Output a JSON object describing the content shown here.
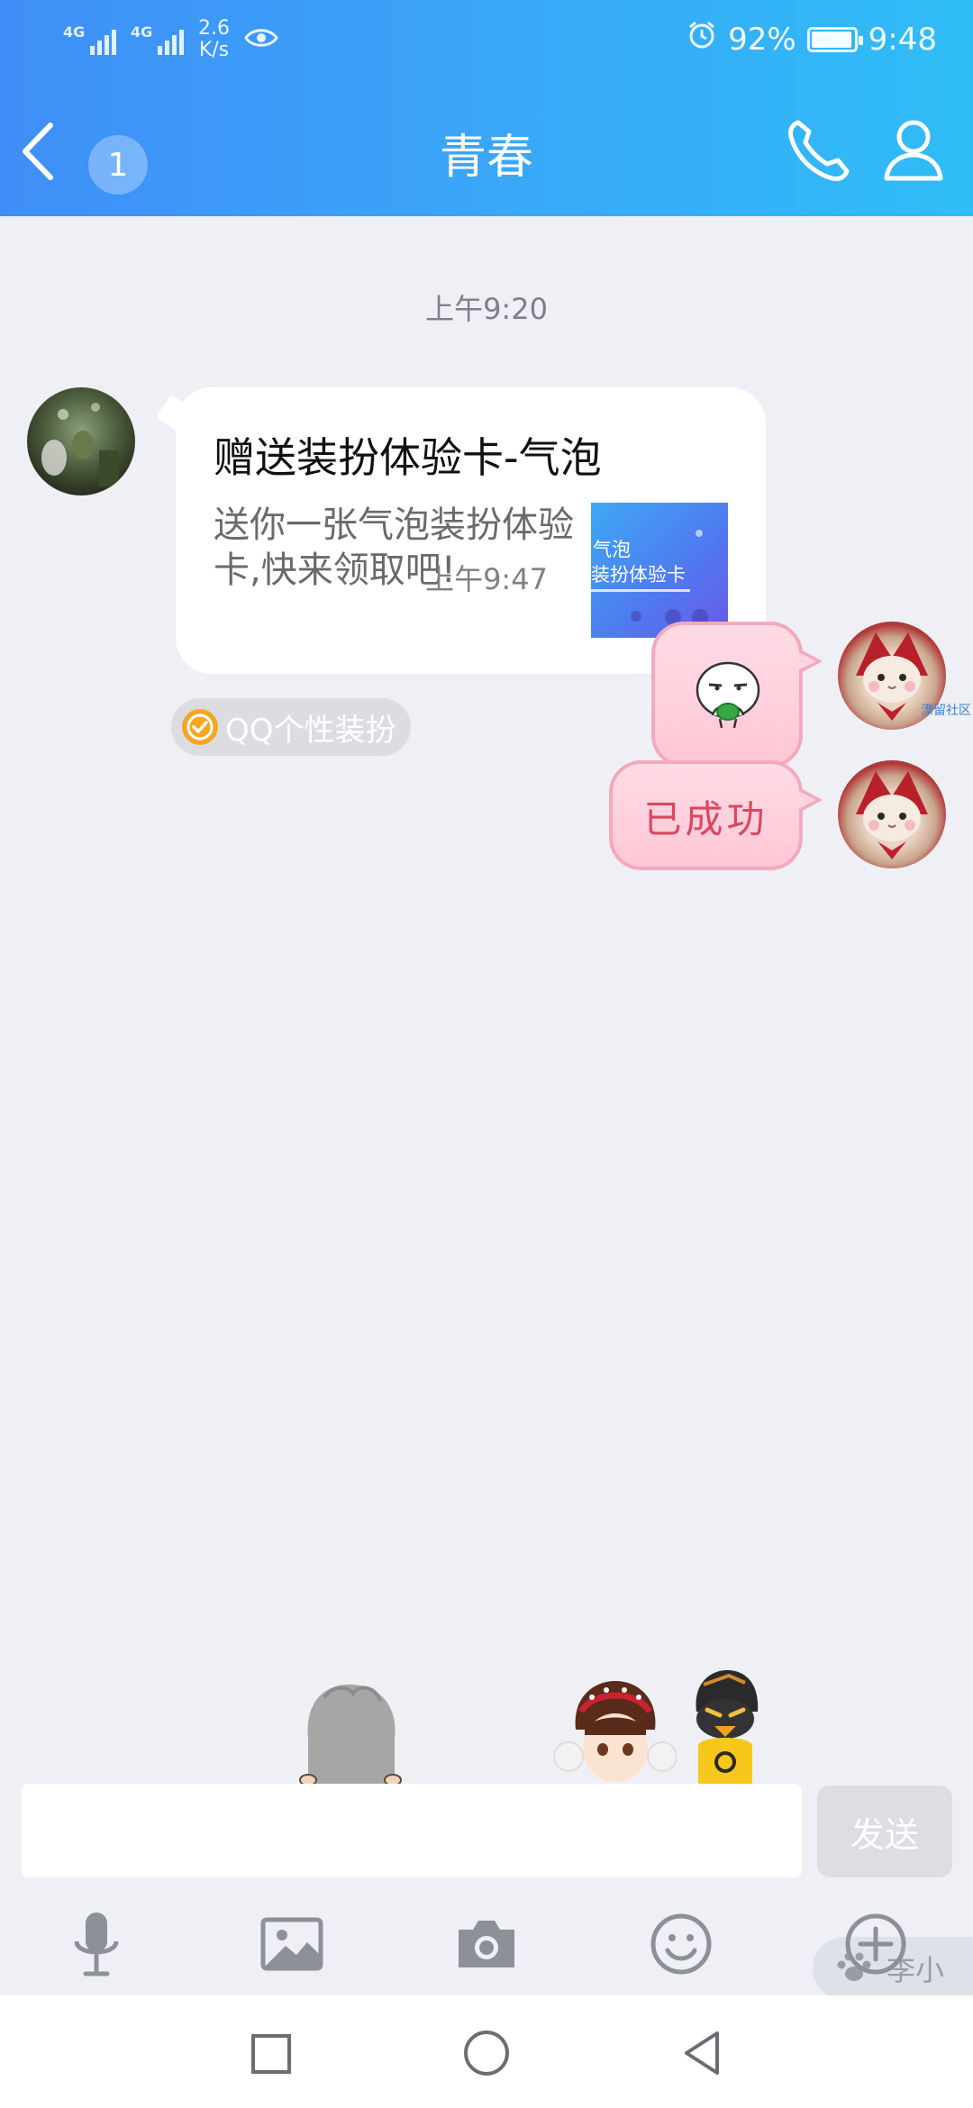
{
  "status_bar": {
    "signal1_tag": "4G",
    "signal2_tag": "4G",
    "speed_value": "2.6",
    "speed_unit": "K/s",
    "battery": "92%",
    "time": "9:48",
    "icons": [
      "eye-icon",
      "alarm-icon",
      "battery-icon"
    ]
  },
  "header": {
    "unread_count": "1",
    "title": "青春",
    "icons": [
      "back-icon",
      "phone-icon",
      "profile-icon"
    ]
  },
  "chat": {
    "timestamp1": "上午9:20",
    "card": {
      "title": "赠送装扮体验卡-气泡",
      "description": "送你一张气泡装扮体验卡,快来领取吧!",
      "thumb_line1": "气泡",
      "thumb_line2": "装扮体验卡"
    },
    "source_tag": "QQ个性装扮",
    "timestamp2": "上午9:47",
    "sent_text": "已成功",
    "brand_mark": "漂留社区"
  },
  "floating_chip": {
    "label": "李小",
    "icon": "paw-icon"
  },
  "composer": {
    "input_value": "",
    "input_placeholder": "",
    "send_label": "发送"
  },
  "toolbar": {
    "items": [
      "microphone-icon",
      "image-icon",
      "camera-icon",
      "emoji-icon",
      "plus-icon"
    ]
  },
  "system_nav": {
    "items": [
      "recent-apps-icon",
      "home-icon",
      "back-nav-icon"
    ]
  },
  "colors": {
    "header_start": "#3f8ef7",
    "header_end": "#2fbdf7",
    "chat_background": "#eff0f6",
    "bubble_pink": "#ffc7d6",
    "bubble_text": "#d8485f"
  }
}
